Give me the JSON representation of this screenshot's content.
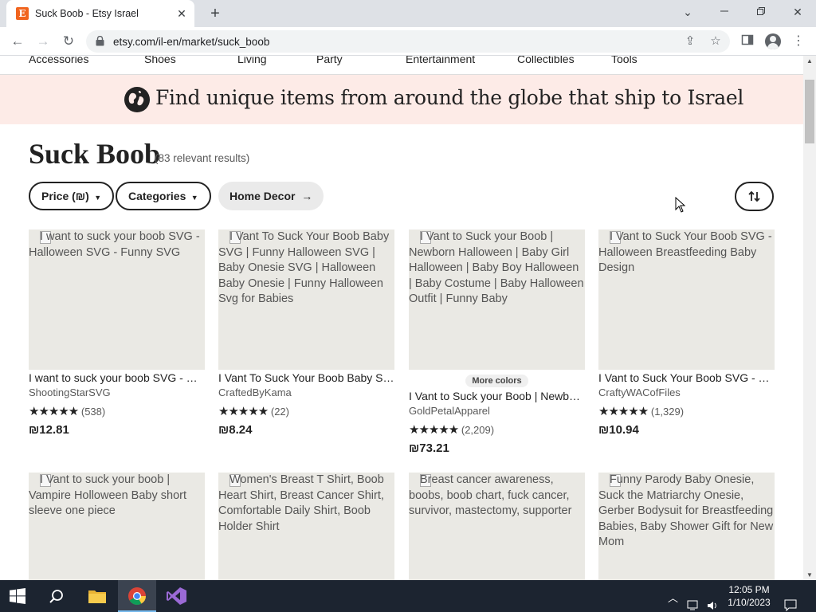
{
  "browser": {
    "tab_title": "Suck Boob - Etsy Israel",
    "favicon_letter": "E",
    "url": "etsy.com/il-en/market/suck_boob"
  },
  "categories": [
    "Accessories",
    "Shoes",
    "Living",
    "Party",
    "Entertainment",
    "Collectibles",
    "Tools"
  ],
  "banner": {
    "text": "Find unique items from around the globe that ship to Israel"
  },
  "search": {
    "title": "Suck Boob",
    "result_count": "(83 relevant results)"
  },
  "filters": {
    "price_label": "Price (₪)",
    "categories_label": "Categories",
    "home_decor_label": "Home Decor"
  },
  "listings": [
    {
      "alt": "I want to suck your boob SVG - Halloween SVG - Funny SVG",
      "title": "I want to suck your boob SVG - Halloween SVG - Funny SVG",
      "shop": "ShootingStarSVG",
      "reviews": "(538)",
      "price": "₪12.81",
      "more_colors": ""
    },
    {
      "alt": "I Vant To Suck Your Boob Baby SVG | Funny Halloween SVG | Baby Onesie SVG | Halloween Baby Onesie | Funny Halloween Svg for Babies",
      "title": "I Vant To Suck Your Boob Baby SVG | Funny Halloween SVG",
      "shop": "CraftedByKama",
      "reviews": "(22)",
      "price": "₪8.24",
      "more_colors": ""
    },
    {
      "alt": "I Vant to Suck your Boob | Newborn Halloween | Baby Girl Halloween | Baby Boy Halloween | Baby Costume | Baby Halloween Outfit | Funny Baby",
      "title": "I Vant to Suck your Boob | Newborn Halloween | Baby Girl",
      "shop": "GoldPetalApparel",
      "reviews": "(2,209)",
      "price": "₪73.21",
      "more_colors": "More colors"
    },
    {
      "alt": "I Vant to Suck Your Boob SVG - Halloween Breastfeeding Baby Design",
      "title": "I Vant to Suck Your Boob SVG - Halloween Breastfeeding Baby Design",
      "shop": "CraftyWACofFiles",
      "reviews": "(1,329)",
      "price": "₪10.94",
      "more_colors": ""
    },
    {
      "alt": "I Vant to suck your boob | Vampire Holloween Baby short sleeve one piece",
      "title": "",
      "shop": "",
      "reviews": "",
      "price": "",
      "more_colors": ""
    },
    {
      "alt": "Women's Breast T Shirt, Boob Heart Shirt, Breast Cancer Shirt, Comfortable Daily Shirt, Boob Holder Shirt",
      "title": "",
      "shop": "",
      "reviews": "",
      "price": "",
      "more_colors": ""
    },
    {
      "alt": "Breast cancer awareness, boobs, boob chart, fuck cancer, survivor, mastectomy, supporter",
      "title": "",
      "shop": "",
      "reviews": "",
      "price": "",
      "more_colors": ""
    },
    {
      "alt": "Funny Parody Baby Onesie, Suck the Matriarchy Onesie, Gerber Bodysuit for Breastfeeding Babies, Baby Shower Gift for New Mom",
      "title": "",
      "shop": "",
      "reviews": "",
      "price": "",
      "more_colors": ""
    }
  ],
  "stars_glyph": "★★★★★",
  "taskbar": {
    "time": "12:05 PM",
    "date": "1/10/2023"
  }
}
